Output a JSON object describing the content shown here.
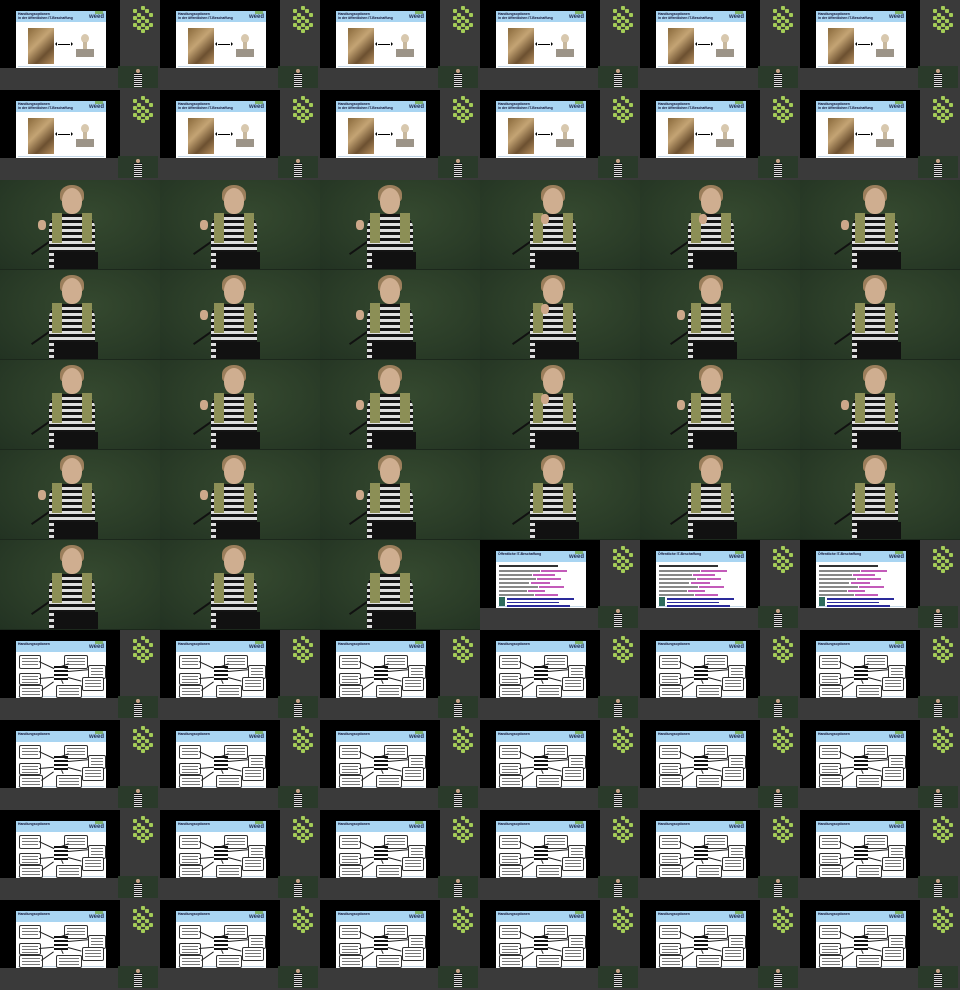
{
  "contact_sheet": {
    "columns": 6,
    "rows": 11,
    "slide_titles": {
      "slide_a": "Handlungsoptionen\nin der öffentlichen IT-Beschaffung",
      "slide_b": "Öffentliche IT-Beschaffung",
      "slide_c": "Handlungsoptionen"
    },
    "brand_text": "weed",
    "frame_kinds": [
      "slide_a",
      "slide_a",
      "slide_a",
      "slide_a",
      "slide_a",
      "slide_a",
      "slide_a",
      "slide_a",
      "slide_a",
      "slide_a",
      "slide_a",
      "slide_a",
      "speaker",
      "speaker",
      "speaker",
      "speaker",
      "speaker",
      "speaker",
      "speaker",
      "speaker",
      "speaker",
      "speaker",
      "speaker",
      "speaker",
      "speaker",
      "speaker",
      "speaker",
      "speaker",
      "speaker",
      "speaker",
      "speaker",
      "speaker",
      "speaker",
      "speaker",
      "speaker",
      "speaker",
      "speaker",
      "speaker",
      "speaker",
      "slide_b",
      "slide_b",
      "slide_b",
      "slide_c",
      "slide_c",
      "slide_c",
      "slide_c",
      "slide_c",
      "slide_c",
      "slide_c",
      "slide_c",
      "slide_c",
      "slide_c",
      "slide_c",
      "slide_c",
      "slide_c",
      "slide_c",
      "slide_c",
      "slide_c",
      "slide_c",
      "slide_c",
      "slide_c",
      "slide_c",
      "slide_c",
      "slide_c",
      "slide_c",
      "slide_c"
    ],
    "speaker_gestures": [
      "hand-left",
      "hand-left",
      "hand-left",
      "hand-mouth",
      "hand-mouth",
      "hand-left",
      "none",
      "hand-left",
      "hand-left",
      "hand-mouth",
      "hand-left",
      "none",
      "none",
      "hand-left",
      "hand-left",
      "hand-mouth",
      "hand-left",
      "hand-left",
      "hand-left",
      "hand-left",
      "hand-left",
      "none",
      "none",
      "none",
      "none",
      "none",
      "none"
    ],
    "colors": {
      "background": "#3b3b3b",
      "slide_header": "#a9d5f2",
      "logo_green": "#a4cc57",
      "stage_green": "#2b3d28"
    }
  }
}
